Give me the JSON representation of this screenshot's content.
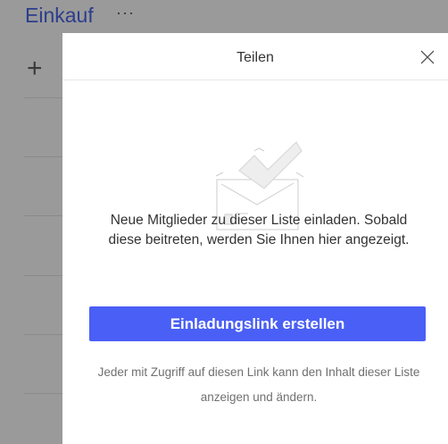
{
  "list": {
    "title": "Einkauf",
    "more_label": "···",
    "add_label": "+"
  },
  "dialog": {
    "title": "Teilen",
    "message": "Neue Mitglieder zu dieser Liste einladen. Sobald diese beitreten, werden Sie Ihnen hier angezeigt.",
    "button_label": "Einladungslink erstellen",
    "note": "Jeder mit Zugriff auf diesen Link kann den Inhalt dieser Liste anzeigen und ändern."
  },
  "colors": {
    "accent": "#4a5ff5",
    "title": "#2c3d8c"
  }
}
